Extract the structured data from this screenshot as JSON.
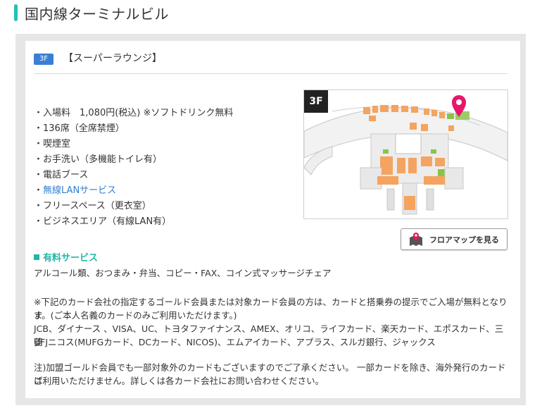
{
  "page": {
    "title": "国内線ターミナルビル"
  },
  "lounge": {
    "floor": "3F",
    "name": "【スーパーラウンジ】",
    "facilities": [
      {
        "prefix": "・",
        "text": "入場料　1,080円(税込) ※ソフトドリンク無料"
      },
      {
        "prefix": "・",
        "text": "136席（全席禁煙）"
      },
      {
        "prefix": "・",
        "text": "喫煙室"
      },
      {
        "prefix": "・",
        "text": "お手洗い（多機能トイレ有）"
      },
      {
        "prefix": "・",
        "text": "電話ブース"
      },
      {
        "prefix": "・",
        "text": "無線LANサービス"
      },
      {
        "prefix": "・",
        "text": "フリースペース（更衣室）"
      },
      {
        "prefix": "・",
        "text": "ビジネスエリア（有線LAN有）"
      }
    ],
    "map": {
      "floor_badge": "3F",
      "button_label": "フロアマップを見る"
    },
    "paid_services": {
      "heading": "有料サービス",
      "text": "アルコール類、おつまみ・弁当、コピー・FAX、コイン式マッサージチェア"
    },
    "card_note": {
      "line1": "※下記のカード会社の指定するゴールド会員または対象カード会員の方は、カードと搭乗券の提示でご入場が無料となりま",
      "line2": "す。(ご本人名義のカードのみご利用いただけます。)",
      "line3": "JCB、ダイナース 、VISA、UC、トヨタファイナンス、AMEX、オリコ、ライフカード、楽天カード、エポスカード、三菱",
      "line4": "UFJニコス(MUFGカード、DCカード、NICOS)、エムアイカード、アプラス、スルガ銀行、ジャックス"
    },
    "footnote": {
      "line1": "注)加盟ゴールド会員でも一部対象外のカードもございますのでご了承ください。 一部カードを除き、海外発行のカードは",
      "line2": "ご利用いただけません。詳しくは各カード会社にお問い合わせください。"
    }
  },
  "colors": {
    "accent": "#1fc3b3",
    "floor_tag": "#3a7fd5",
    "link": "#2f7fcf",
    "pin": "#e8176b"
  }
}
